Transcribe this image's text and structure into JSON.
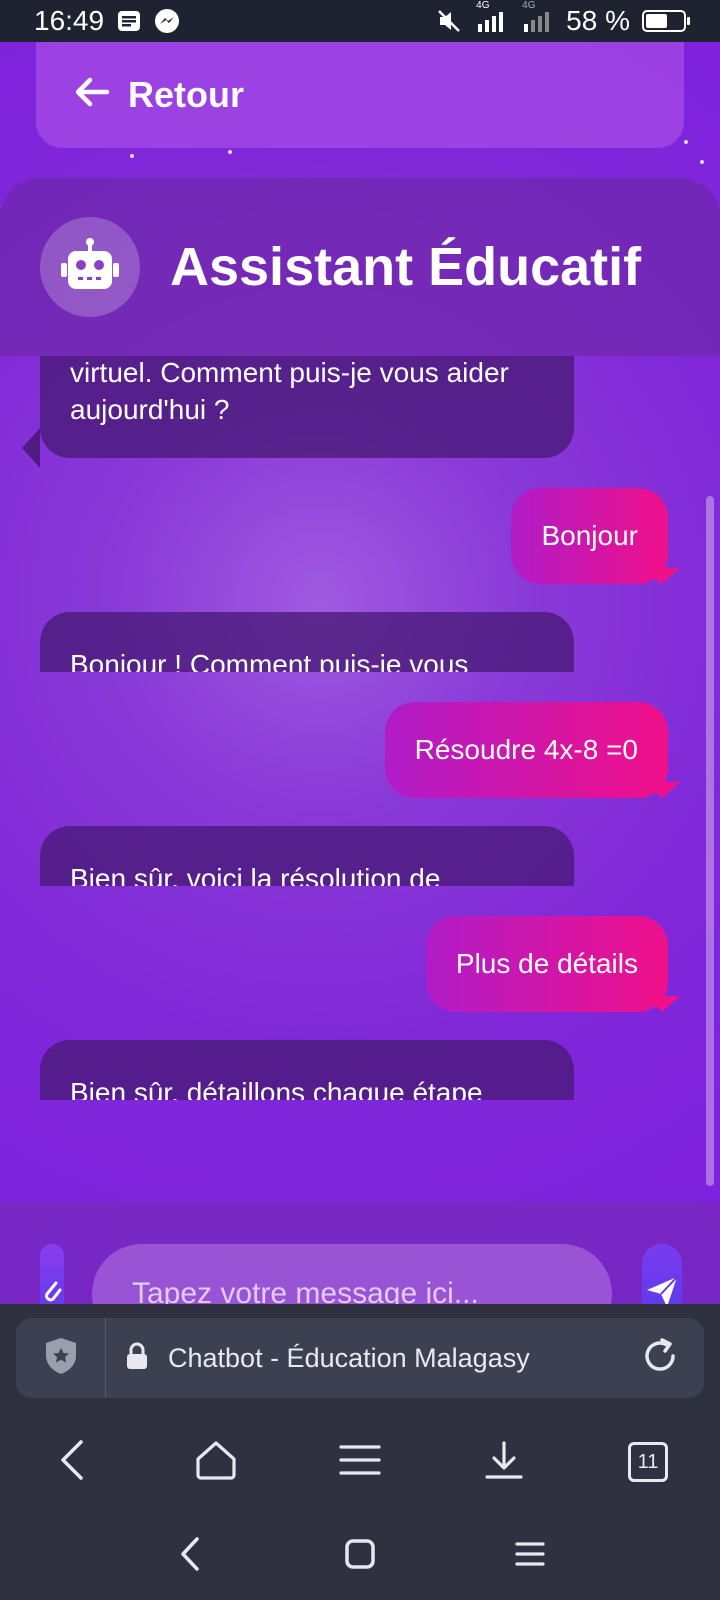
{
  "status_bar": {
    "time": "16:49",
    "battery_percent": "58 %",
    "battery_level": 0.58,
    "network_labels": [
      "4G",
      "4G"
    ]
  },
  "app": {
    "back_label": "Retour",
    "header_title": "Assistant Éducatif",
    "messages": [
      {
        "role": "bot",
        "text": "virtuel. Comment puis-je vous aider aujourd'hui ?"
      },
      {
        "role": "user",
        "text": "Bonjour"
      },
      {
        "role": "bot",
        "text": "Bonjour ! Comment puis-je vous"
      },
      {
        "role": "user",
        "text": "Résoudre 4x-8 =0"
      },
      {
        "role": "bot",
        "text": "Bien sûr, voici la résolution de"
      },
      {
        "role": "user",
        "text": "Plus de détails"
      },
      {
        "role": "bot",
        "text": "Bien sûr, détaillons chaque étape"
      }
    ],
    "composer": {
      "placeholder": "Tapez votre message ici..."
    }
  },
  "browser": {
    "page_title": "Chatbot - Éducation Malagasy",
    "tab_count": "11"
  },
  "colors": {
    "purple_bg": "#8028d8",
    "user_bubble_start": "#b01cc8",
    "user_bubble_end": "#f0108a",
    "bot_bubble": "#461973",
    "browser_bg": "#2f3140"
  }
}
